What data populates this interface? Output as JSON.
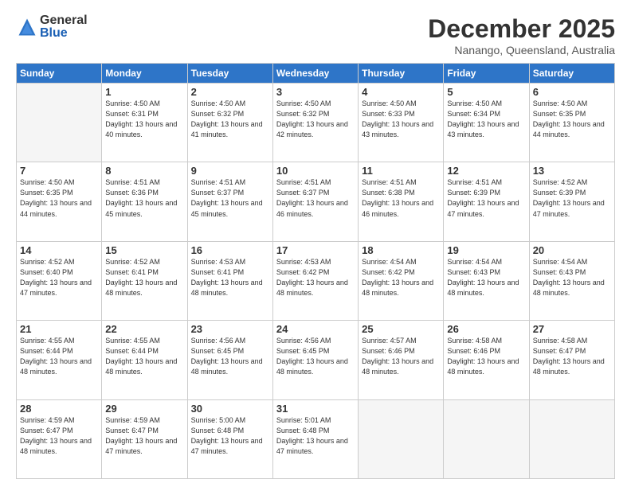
{
  "logo": {
    "general": "General",
    "blue": "Blue"
  },
  "header": {
    "month": "December 2025",
    "location": "Nanango, Queensland, Australia"
  },
  "weekdays": [
    "Sunday",
    "Monday",
    "Tuesday",
    "Wednesday",
    "Thursday",
    "Friday",
    "Saturday"
  ],
  "weeks": [
    [
      {
        "day": "",
        "sunrise": "",
        "sunset": "",
        "daylight": ""
      },
      {
        "day": "1",
        "sunrise": "Sunrise: 4:50 AM",
        "sunset": "Sunset: 6:31 PM",
        "daylight": "Daylight: 13 hours and 40 minutes."
      },
      {
        "day": "2",
        "sunrise": "Sunrise: 4:50 AM",
        "sunset": "Sunset: 6:32 PM",
        "daylight": "Daylight: 13 hours and 41 minutes."
      },
      {
        "day": "3",
        "sunrise": "Sunrise: 4:50 AM",
        "sunset": "Sunset: 6:32 PM",
        "daylight": "Daylight: 13 hours and 42 minutes."
      },
      {
        "day": "4",
        "sunrise": "Sunrise: 4:50 AM",
        "sunset": "Sunset: 6:33 PM",
        "daylight": "Daylight: 13 hours and 43 minutes."
      },
      {
        "day": "5",
        "sunrise": "Sunrise: 4:50 AM",
        "sunset": "Sunset: 6:34 PM",
        "daylight": "Daylight: 13 hours and 43 minutes."
      },
      {
        "day": "6",
        "sunrise": "Sunrise: 4:50 AM",
        "sunset": "Sunset: 6:35 PM",
        "daylight": "Daylight: 13 hours and 44 minutes."
      }
    ],
    [
      {
        "day": "7",
        "sunrise": "Sunrise: 4:50 AM",
        "sunset": "Sunset: 6:35 PM",
        "daylight": "Daylight: 13 hours and 44 minutes."
      },
      {
        "day": "8",
        "sunrise": "Sunrise: 4:51 AM",
        "sunset": "Sunset: 6:36 PM",
        "daylight": "Daylight: 13 hours and 45 minutes."
      },
      {
        "day": "9",
        "sunrise": "Sunrise: 4:51 AM",
        "sunset": "Sunset: 6:37 PM",
        "daylight": "Daylight: 13 hours and 45 minutes."
      },
      {
        "day": "10",
        "sunrise": "Sunrise: 4:51 AM",
        "sunset": "Sunset: 6:37 PM",
        "daylight": "Daylight: 13 hours and 46 minutes."
      },
      {
        "day": "11",
        "sunrise": "Sunrise: 4:51 AM",
        "sunset": "Sunset: 6:38 PM",
        "daylight": "Daylight: 13 hours and 46 minutes."
      },
      {
        "day": "12",
        "sunrise": "Sunrise: 4:51 AM",
        "sunset": "Sunset: 6:39 PM",
        "daylight": "Daylight: 13 hours and 47 minutes."
      },
      {
        "day": "13",
        "sunrise": "Sunrise: 4:52 AM",
        "sunset": "Sunset: 6:39 PM",
        "daylight": "Daylight: 13 hours and 47 minutes."
      }
    ],
    [
      {
        "day": "14",
        "sunrise": "Sunrise: 4:52 AM",
        "sunset": "Sunset: 6:40 PM",
        "daylight": "Daylight: 13 hours and 47 minutes."
      },
      {
        "day": "15",
        "sunrise": "Sunrise: 4:52 AM",
        "sunset": "Sunset: 6:41 PM",
        "daylight": "Daylight: 13 hours and 48 minutes."
      },
      {
        "day": "16",
        "sunrise": "Sunrise: 4:53 AM",
        "sunset": "Sunset: 6:41 PM",
        "daylight": "Daylight: 13 hours and 48 minutes."
      },
      {
        "day": "17",
        "sunrise": "Sunrise: 4:53 AM",
        "sunset": "Sunset: 6:42 PM",
        "daylight": "Daylight: 13 hours and 48 minutes."
      },
      {
        "day": "18",
        "sunrise": "Sunrise: 4:54 AM",
        "sunset": "Sunset: 6:42 PM",
        "daylight": "Daylight: 13 hours and 48 minutes."
      },
      {
        "day": "19",
        "sunrise": "Sunrise: 4:54 AM",
        "sunset": "Sunset: 6:43 PM",
        "daylight": "Daylight: 13 hours and 48 minutes."
      },
      {
        "day": "20",
        "sunrise": "Sunrise: 4:54 AM",
        "sunset": "Sunset: 6:43 PM",
        "daylight": "Daylight: 13 hours and 48 minutes."
      }
    ],
    [
      {
        "day": "21",
        "sunrise": "Sunrise: 4:55 AM",
        "sunset": "Sunset: 6:44 PM",
        "daylight": "Daylight: 13 hours and 48 minutes."
      },
      {
        "day": "22",
        "sunrise": "Sunrise: 4:55 AM",
        "sunset": "Sunset: 6:44 PM",
        "daylight": "Daylight: 13 hours and 48 minutes."
      },
      {
        "day": "23",
        "sunrise": "Sunrise: 4:56 AM",
        "sunset": "Sunset: 6:45 PM",
        "daylight": "Daylight: 13 hours and 48 minutes."
      },
      {
        "day": "24",
        "sunrise": "Sunrise: 4:56 AM",
        "sunset": "Sunset: 6:45 PM",
        "daylight": "Daylight: 13 hours and 48 minutes."
      },
      {
        "day": "25",
        "sunrise": "Sunrise: 4:57 AM",
        "sunset": "Sunset: 6:46 PM",
        "daylight": "Daylight: 13 hours and 48 minutes."
      },
      {
        "day": "26",
        "sunrise": "Sunrise: 4:58 AM",
        "sunset": "Sunset: 6:46 PM",
        "daylight": "Daylight: 13 hours and 48 minutes."
      },
      {
        "day": "27",
        "sunrise": "Sunrise: 4:58 AM",
        "sunset": "Sunset: 6:47 PM",
        "daylight": "Daylight: 13 hours and 48 minutes."
      }
    ],
    [
      {
        "day": "28",
        "sunrise": "Sunrise: 4:59 AM",
        "sunset": "Sunset: 6:47 PM",
        "daylight": "Daylight: 13 hours and 48 minutes."
      },
      {
        "day": "29",
        "sunrise": "Sunrise: 4:59 AM",
        "sunset": "Sunset: 6:47 PM",
        "daylight": "Daylight: 13 hours and 47 minutes."
      },
      {
        "day": "30",
        "sunrise": "Sunrise: 5:00 AM",
        "sunset": "Sunset: 6:48 PM",
        "daylight": "Daylight: 13 hours and 47 minutes."
      },
      {
        "day": "31",
        "sunrise": "Sunrise: 5:01 AM",
        "sunset": "Sunset: 6:48 PM",
        "daylight": "Daylight: 13 hours and 47 minutes."
      },
      {
        "day": "",
        "sunrise": "",
        "sunset": "",
        "daylight": ""
      },
      {
        "day": "",
        "sunrise": "",
        "sunset": "",
        "daylight": ""
      },
      {
        "day": "",
        "sunrise": "",
        "sunset": "",
        "daylight": ""
      }
    ]
  ]
}
